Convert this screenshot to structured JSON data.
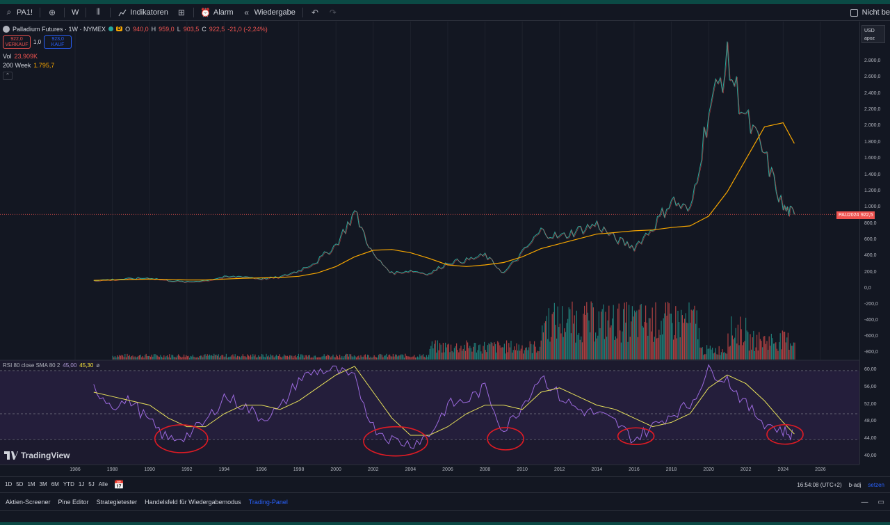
{
  "toolbar": {
    "symbol": "PA1!",
    "interval": "W",
    "indicators_label": "Indikatoren",
    "alarm_label": "Alarm",
    "replay_label": "Wiedergabe",
    "right_label": "Nicht be"
  },
  "legend": {
    "title": "Palladium Futures · 1W · NYMEX",
    "badge": "D",
    "ohlc": {
      "o_label": "O",
      "o": "940,0",
      "h_label": "H",
      "h": "959,0",
      "l_label": "L",
      "l": "903,5",
      "c_label": "C",
      "c": "922,5",
      "change": "-21,0 (-2,24%)"
    },
    "sell_price": "922,0",
    "sell_label": "VERKAUF",
    "qty": "1,0",
    "buy_price": "923,0",
    "buy_label": "KAUF",
    "vol_label": "Vol",
    "vol_value": "23,909K",
    "ma_label": "200 Week",
    "ma_value": "1.795,7"
  },
  "price_axis": {
    "currency": "USD",
    "sub": "apoz",
    "labels": [
      "2.800,0",
      "2.600,0",
      "2.400,0",
      "2.200,0",
      "2.000,0",
      "1.800,0",
      "1.600,0",
      "1.400,0",
      "1.200,0",
      "1.000,0",
      "800,0",
      "600,0",
      "400,0",
      "200,0",
      "0,0",
      "-200,0",
      "-400,0",
      "-600,0",
      "-800,0"
    ],
    "rsi_labels": [
      "60,00",
      "56,00",
      "52,00",
      "48,00",
      "44,00",
      "40,00"
    ],
    "last_price": "922,5",
    "symbol_tag": "PAU2024"
  },
  "rsi": {
    "label": "RSI 80 close SMA 80 2",
    "value_a": "45,00",
    "value_b": "45,30",
    "icon": "ø"
  },
  "brand": "TradingView",
  "time_axis": {
    "years": [
      "1986",
      "1988",
      "1990",
      "1992",
      "1994",
      "1996",
      "1998",
      "2000",
      "2002",
      "2004",
      "2006",
      "2008",
      "2010",
      "2012",
      "2014",
      "2016",
      "2018",
      "2020",
      "2022",
      "2024",
      "2026"
    ]
  },
  "range_bar": {
    "buttons": [
      "1D",
      "5D",
      "1M",
      "3M",
      "6M",
      "YTD",
      "1J",
      "5J",
      "Alle"
    ],
    "time": "16:54:08 (UTC+2)",
    "adj": "b-adj",
    "set": "setzen"
  },
  "bottom_panel": {
    "tabs": [
      "Aktien-Screener",
      "Pine Editor",
      "Strategietester",
      "Handelsfeld für Wiedergabemodus",
      "Trading-Panel"
    ]
  },
  "colors": {
    "background": "#131722",
    "up": "#26a69a",
    "down": "#ef5350",
    "ma": "#f7a600",
    "rsi": "#9c6ade",
    "rsi_sma": "#e8e15a",
    "annotation": "#e01b24"
  },
  "chart_data": {
    "type": "line",
    "title": "Palladium Futures · 1W · NYMEX",
    "x": [
      1987,
      1988,
      1989,
      1990,
      1991,
      1992,
      1993,
      1994,
      1995,
      1996,
      1997,
      1998,
      1999,
      2000,
      2001,
      2002,
      2003,
      2004,
      2005,
      2006,
      2007,
      2008,
      2009,
      2010,
      2011,
      2012,
      2013,
      2014,
      2015,
      2016,
      2017,
      2018,
      2019,
      2020,
      2021,
      2022,
      2023,
      2024,
      2024.6
    ],
    "series": [
      {
        "values": [
          110,
          120,
          130,
          140,
          110,
          90,
          110,
          150,
          160,
          130,
          150,
          230,
          350,
          550,
          950,
          420,
          200,
          230,
          190,
          330,
          360,
          420,
          200,
          450,
          720,
          640,
          730,
          800,
          620,
          520,
          760,
          1100,
          950,
          2200,
          2800,
          2100,
          1650,
          1000,
          922.5
        ]
      },
      {
        "values": [
          110,
          115,
          120,
          125,
          120,
          115,
          115,
          125,
          135,
          140,
          145,
          160,
          200,
          280,
          400,
          480,
          490,
          450,
          380,
          300,
          280,
          300,
          330,
          400,
          500,
          560,
          620,
          680,
          700,
          720,
          730,
          760,
          780,
          900,
          1200,
          1600,
          2000,
          2050,
          1795.7
        ]
      },
      {
        "values": [
          56,
          52,
          53,
          48,
          44,
          45,
          48,
          54,
          52,
          49,
          51,
          58,
          60,
          60,
          58,
          47,
          44,
          43,
          45,
          52,
          53,
          56,
          46,
          52,
          59,
          54,
          51,
          50,
          48,
          44,
          47,
          50,
          52,
          60,
          58,
          52,
          48,
          46,
          45
        ]
      },
      {
        "values": [
          55,
          54,
          53,
          52,
          49,
          47,
          47,
          50,
          52,
          52,
          51,
          53,
          56,
          59,
          61,
          55,
          49,
          45,
          45,
          47,
          50,
          52,
          52,
          51,
          55,
          56,
          54,
          52,
          51,
          49,
          47,
          48,
          50,
          56,
          59,
          57,
          53,
          48,
          45.3
        ]
      }
    ],
    "ylim": [
      -800,
      3000
    ],
    "rsi_ylim": [
      40,
      62
    ]
  }
}
